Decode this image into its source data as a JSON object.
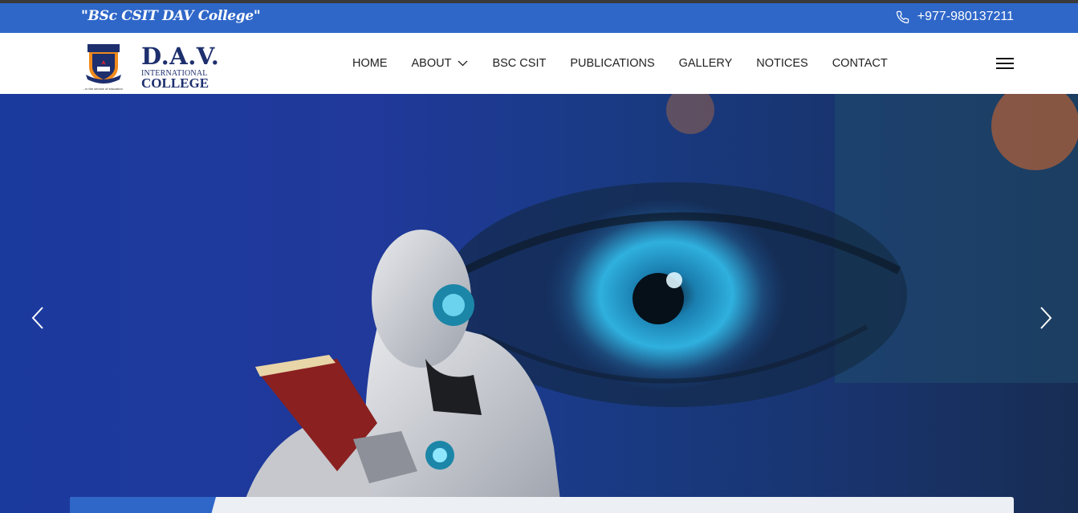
{
  "topbar": {
    "tagline": "\"BSc CSIT DAV College\"",
    "phone": "+977-980137211",
    "phone_icon": "phone-icon",
    "background": "#2f67c9"
  },
  "logo": {
    "name": "D.A.V.",
    "subtitle": "INTERNATIONAL",
    "college": "COLLEGE",
    "motto": "...in the service of education"
  },
  "nav": {
    "items": [
      {
        "label": "HOME"
      },
      {
        "label": "ABOUT",
        "icon": "chevron-down-icon"
      },
      {
        "label": "BSC CSIT"
      },
      {
        "label": "PUBLICATIONS"
      },
      {
        "label": "GALLERY"
      },
      {
        "label": "NOTICES"
      },
      {
        "label": "CONTACT"
      }
    ],
    "menu_icon": "hamburger-icon"
  },
  "hero": {
    "prev_icon": "chevron-left-icon",
    "next_icon": "chevron-right-icon",
    "accent": "#1b3a9e"
  }
}
